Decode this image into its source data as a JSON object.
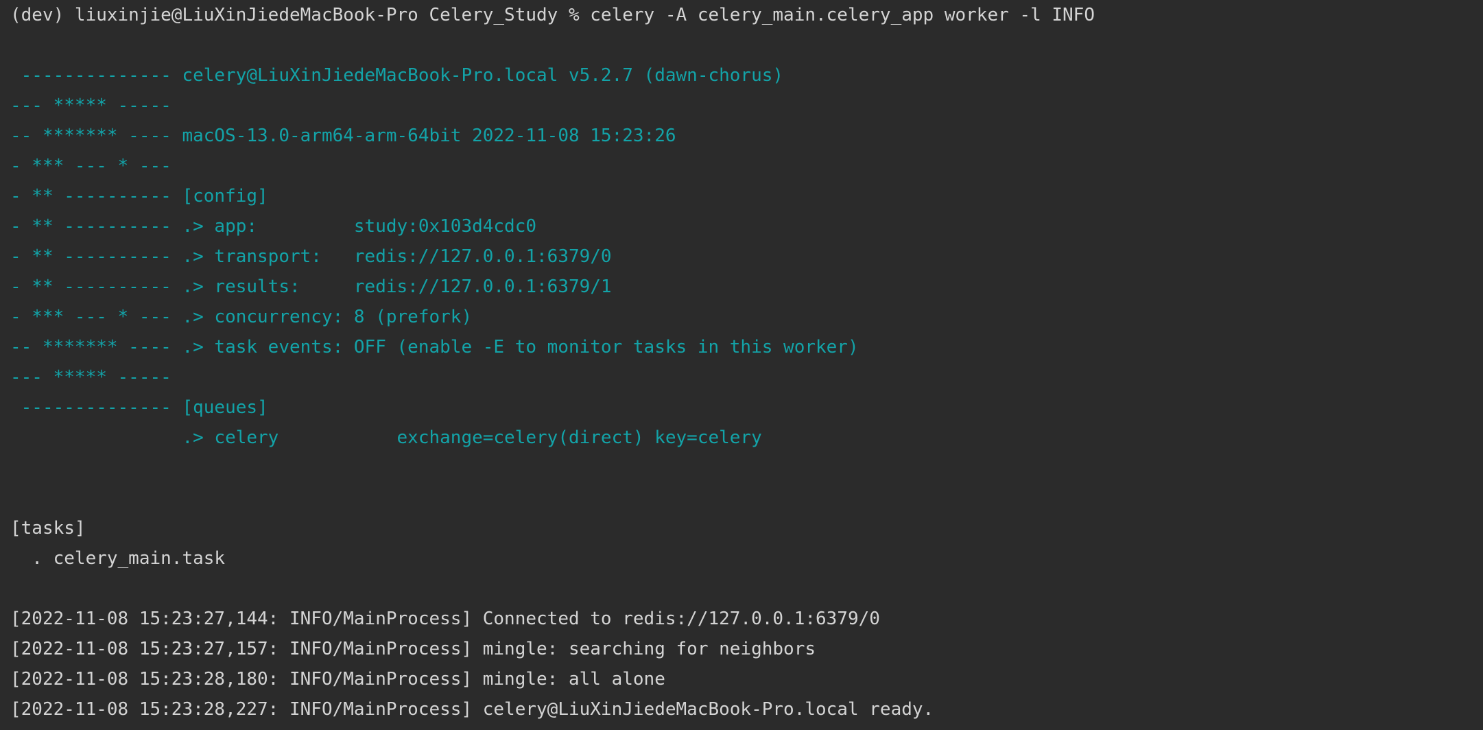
{
  "terminal": {
    "command_line": "(dev) liuxinjie@LiuXinJiedeMacBook-Pro Celery_Study % celery -A celery_main.celery_app worker -l INFO",
    "banner": [
      " -------------- celery@LiuXinJiedeMacBook-Pro.local v5.2.7 (dawn-chorus)",
      "--- ***** -----",
      "-- ******* ---- macOS-13.0-arm64-arm-64bit 2022-11-08 15:23:26",
      "- *** --- * ---",
      "- ** ---------- [config]",
      "- ** ---------- .> app:         study:0x103d4cdc0",
      "- ** ---------- .> transport:   redis://127.0.0.1:6379/0",
      "- ** ---------- .> results:     redis://127.0.0.1:6379/1",
      "- *** --- * --- .> concurrency: 8 (prefork)",
      "-- ******* ---- .> task events: OFF (enable -E to monitor tasks in this worker)",
      "--- ***** -----",
      " -------------- [queues]",
      "                .> celery           exchange=celery(direct) key=celery"
    ],
    "tasks_header": "[tasks]",
    "tasks": [
      "  . celery_main.task"
    ],
    "log_lines": [
      "[2022-11-08 15:23:27,144: INFO/MainProcess] Connected to redis://127.0.0.1:6379/0",
      "[2022-11-08 15:23:27,157: INFO/MainProcess] mingle: searching for neighbors",
      "[2022-11-08 15:23:28,180: INFO/MainProcess] mingle: all alone",
      "[2022-11-08 15:23:28,227: INFO/MainProcess] celery@LiuXinJiedeMacBook-Pro.local ready."
    ]
  },
  "colors": {
    "background": "#2b2b2b",
    "default_text": "#d4d4d4",
    "banner_text": "#13a3a8"
  }
}
